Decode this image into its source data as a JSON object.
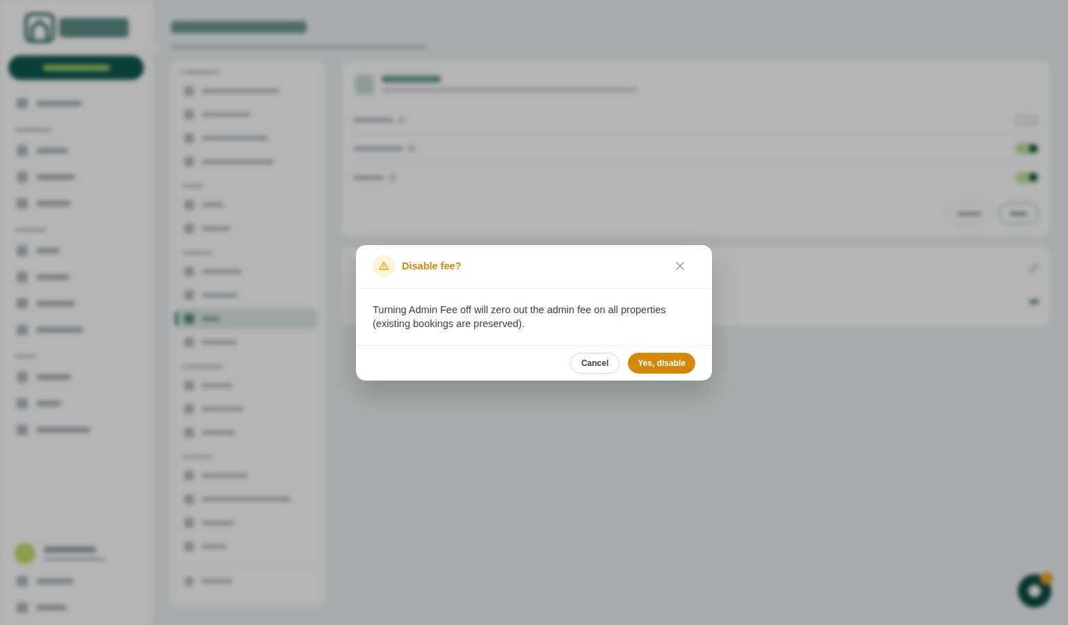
{
  "backdrop": {
    "settings_nav": [
      {
        "selected": false
      },
      {
        "selected": false
      },
      {
        "selected": false
      },
      {
        "selected": false
      },
      {
        "selected": false
      },
      {
        "selected": false
      },
      {
        "selected": false
      },
      {
        "selected": false
      },
      {
        "selected": true
      },
      {
        "selected": false
      },
      {
        "selected": false
      },
      {
        "selected": false
      },
      {
        "selected": false
      },
      {
        "selected": false
      },
      {
        "selected": false
      },
      {
        "selected": false
      },
      {
        "selected": false
      },
      {
        "selected": false
      }
    ],
    "fee_toggles": [
      {
        "on": false
      },
      {
        "on": true
      },
      {
        "on": true
      }
    ]
  },
  "dialog": {
    "title": "Disable fee?",
    "message": "Turning Admin Fee off will zero out the admin fee on all properties (existing bookings are preserved).",
    "buttons": [
      {
        "label": "Cancel",
        "kind": "secondary"
      },
      {
        "label": "Yes, disable",
        "kind": "primary"
      }
    ]
  }
}
